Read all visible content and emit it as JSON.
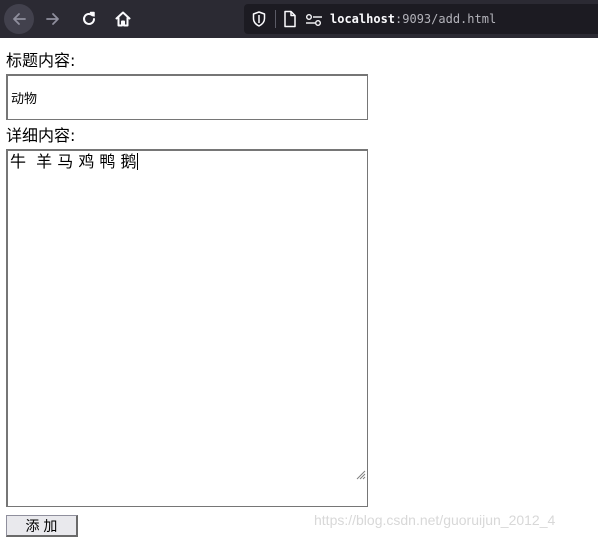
{
  "browser": {
    "url_host": "localhost",
    "url_rest": ":9093/add.html",
    "icons": {
      "back": "arrow-left-icon",
      "forward": "arrow-right-icon",
      "reload": "reload-icon",
      "home": "home-icon",
      "shield": "tracking-shield-icon",
      "page": "page-icon",
      "permissions": "permissions-icon"
    }
  },
  "form": {
    "title_label": "标题内容:",
    "title_value": "动物",
    "detail_label": "详细内容:",
    "detail_value": "牛  羊 马 鸡 鸭 鹅",
    "submit_label": "添 加"
  },
  "watermark": "https://blog.csdn.net/guoruijun_2012_4",
  "colors": {
    "toolbar_bg": "#2b2a33",
    "urlbar_bg": "#1c1b22",
    "button_bg": "#e9e9ed"
  }
}
